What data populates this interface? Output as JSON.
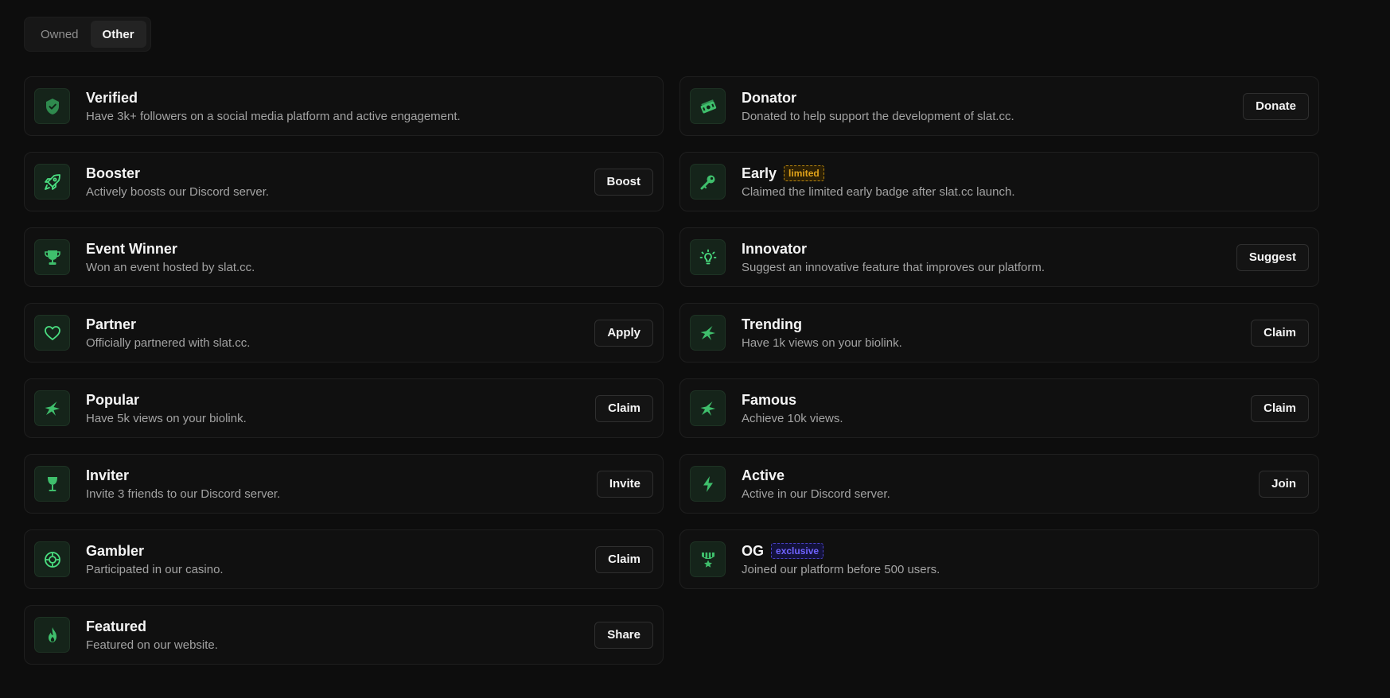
{
  "tabs": [
    {
      "label": "Owned",
      "active": false
    },
    {
      "label": "Other",
      "active": true
    }
  ],
  "colors": {
    "accent": "#4ade80",
    "limited": "#e0a21a",
    "exclusive": "#6f63ff"
  },
  "badges_left": [
    {
      "title": "Verified",
      "description": "Have 3k+ followers on a social media platform and active engagement.",
      "icon": "shield-check-icon",
      "action": null,
      "tag": null
    },
    {
      "title": "Booster",
      "description": "Actively boosts our Discord server.",
      "icon": "rocket-icon",
      "action": "Boost",
      "tag": null
    },
    {
      "title": "Event Winner",
      "description": "Won an event hosted by slat.cc.",
      "icon": "trophy-icon",
      "action": null,
      "tag": null
    },
    {
      "title": "Partner",
      "description": "Officially partnered with slat.cc.",
      "icon": "heart-icon",
      "action": "Apply",
      "tag": null
    },
    {
      "title": "Popular",
      "description": "Have 5k views on your biolink.",
      "icon": "sparkle-star-icon",
      "action": "Claim",
      "tag": null
    },
    {
      "title": "Inviter",
      "description": "Invite 3 friends to our Discord server.",
      "icon": "wine-glass-icon",
      "action": "Invite",
      "tag": null
    },
    {
      "title": "Gambler",
      "description": "Participated in our casino.",
      "icon": "poker-chip-icon",
      "action": "Claim",
      "tag": null
    },
    {
      "title": "Featured",
      "description": "Featured on our website.",
      "icon": "flame-icon",
      "action": "Share",
      "tag": null
    }
  ],
  "badges_right": [
    {
      "title": "Donator",
      "description": "Donated to help support the development of slat.cc.",
      "icon": "money-icon",
      "action": "Donate",
      "tag": null
    },
    {
      "title": "Early",
      "description": "Claimed the limited early badge after slat.cc launch.",
      "icon": "key-icon",
      "action": null,
      "tag": "limited"
    },
    {
      "title": "Innovator",
      "description": "Suggest an innovative feature that improves our platform.",
      "icon": "lightbulb-icon",
      "action": "Suggest",
      "tag": null
    },
    {
      "title": "Trending",
      "description": "Have 1k views on your biolink.",
      "icon": "sparkle-star-icon",
      "action": "Claim",
      "tag": null
    },
    {
      "title": "Famous",
      "description": "Achieve 10k views.",
      "icon": "sparkle-star-icon",
      "action": "Claim",
      "tag": null
    },
    {
      "title": "Active",
      "description": "Active in our Discord server.",
      "icon": "lightning-icon",
      "action": "Join",
      "tag": null
    },
    {
      "title": "OG",
      "description": "Joined our platform before 500 users.",
      "icon": "medal-icon",
      "action": null,
      "tag": "exclusive"
    }
  ]
}
